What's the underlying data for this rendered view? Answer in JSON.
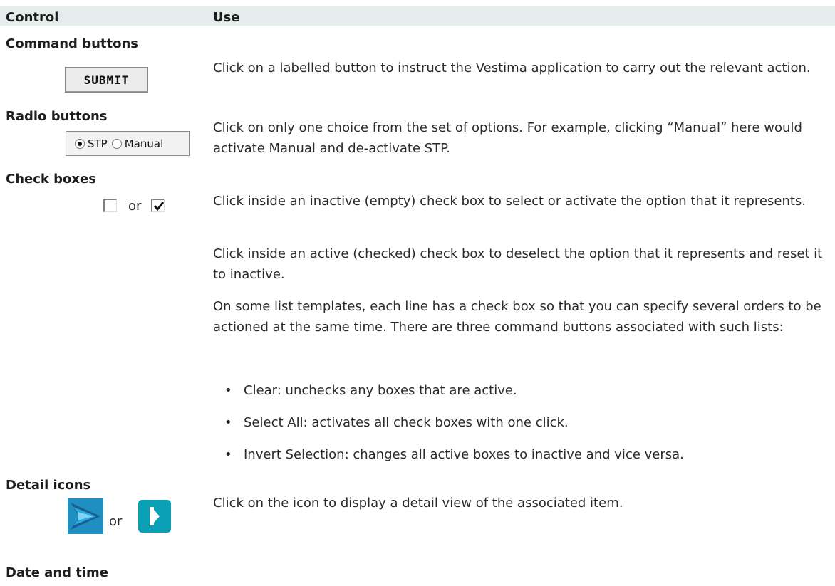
{
  "table": {
    "col_control": "Control",
    "col_use": "Use"
  },
  "command_buttons": {
    "title": "Command buttons",
    "button_label": "SUBMIT",
    "description": "Click on a labelled button to instruct the Vestima application to carry out the relevant action."
  },
  "radio_buttons": {
    "title": "Radio buttons",
    "option_1": "STP",
    "option_2": "Manual",
    "selected": "STP",
    "description": "Click on only one choice from the set of options. For example, clicking “Manual” here would activate Manual and de-activate STP."
  },
  "check_boxes": {
    "title": "Check boxes",
    "or_text": "or",
    "para_1": "Click inside an inactive (empty) check box to select or activate the option that it represents.",
    "para_2": "Click inside an active (checked) check box to deselect the option that it represents and reset it to inactive.",
    "para_3": "On some list templates, each line has a check box so that you can specify several orders to be actioned at the same time. There are three command buttons associated with such lists:",
    "bullets": [
      "Clear: unchecks any boxes that are active.",
      "Select All: activates all check boxes with one click.",
      "Invert Selection: changes all active boxes to inactive and vice versa."
    ],
    "bullet_symbol": "•"
  },
  "detail_icons": {
    "title": "Detail icons",
    "or_text": "or",
    "description": "Click on the icon to display a detail view of the associated item.",
    "icon_colors": {
      "arrow_dark": "#1a5f8f",
      "arrow_light": "#27a9e1",
      "square": "#0aa0b5"
    }
  },
  "date_time": {
    "title": "Date and time"
  }
}
